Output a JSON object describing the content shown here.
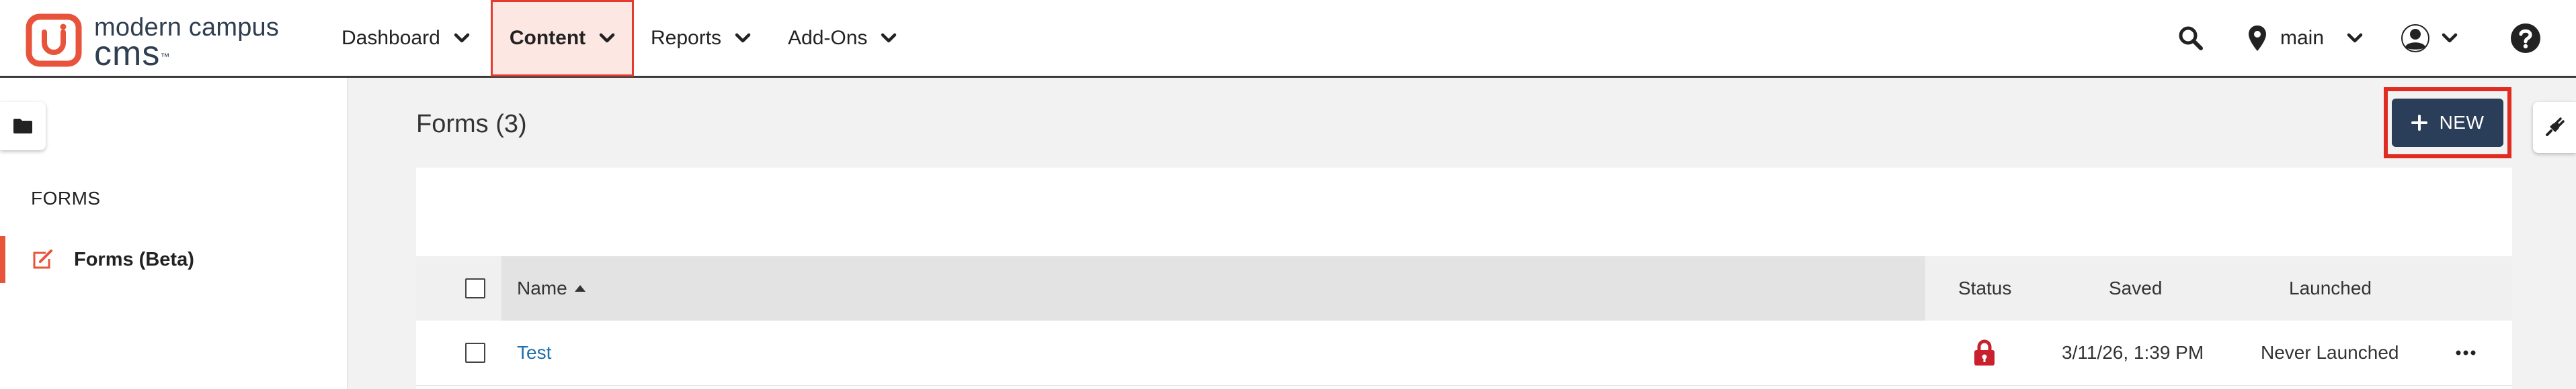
{
  "brand": {
    "line1": "modern campus",
    "line2": "cms",
    "tm": "™",
    "accent": "#e8543b"
  },
  "nav": {
    "items": [
      {
        "label": "Dashboard"
      },
      {
        "label": "Content"
      },
      {
        "label": "Reports"
      },
      {
        "label": "Add-Ons"
      }
    ],
    "active": "Content",
    "branch_label": "main",
    "icons": [
      "search-icon",
      "map-pin-icon",
      "user-icon",
      "help-icon"
    ]
  },
  "sidebar": {
    "heading": "FORMS",
    "items": [
      {
        "label": "Forms (Beta)",
        "icon": "edit-icon"
      }
    ]
  },
  "main": {
    "title": "Forms (3)",
    "new_button": "NEW",
    "columns": {
      "name": "Name",
      "status": "Status",
      "saved": "Saved",
      "launched": "Launched"
    },
    "sort": "name-ascending",
    "rows": [
      {
        "name": "Test",
        "status": "locked",
        "saved": "3/11/26, 1:39 PM",
        "launched": "Never Launched"
      }
    ]
  },
  "colors": {
    "navy_button": "#2a3d59",
    "highlight_red": "#e02b20",
    "active_tab_bg": "#fde7e3",
    "link_blue": "#1e6fb0",
    "lock_red": "#c8202c"
  }
}
